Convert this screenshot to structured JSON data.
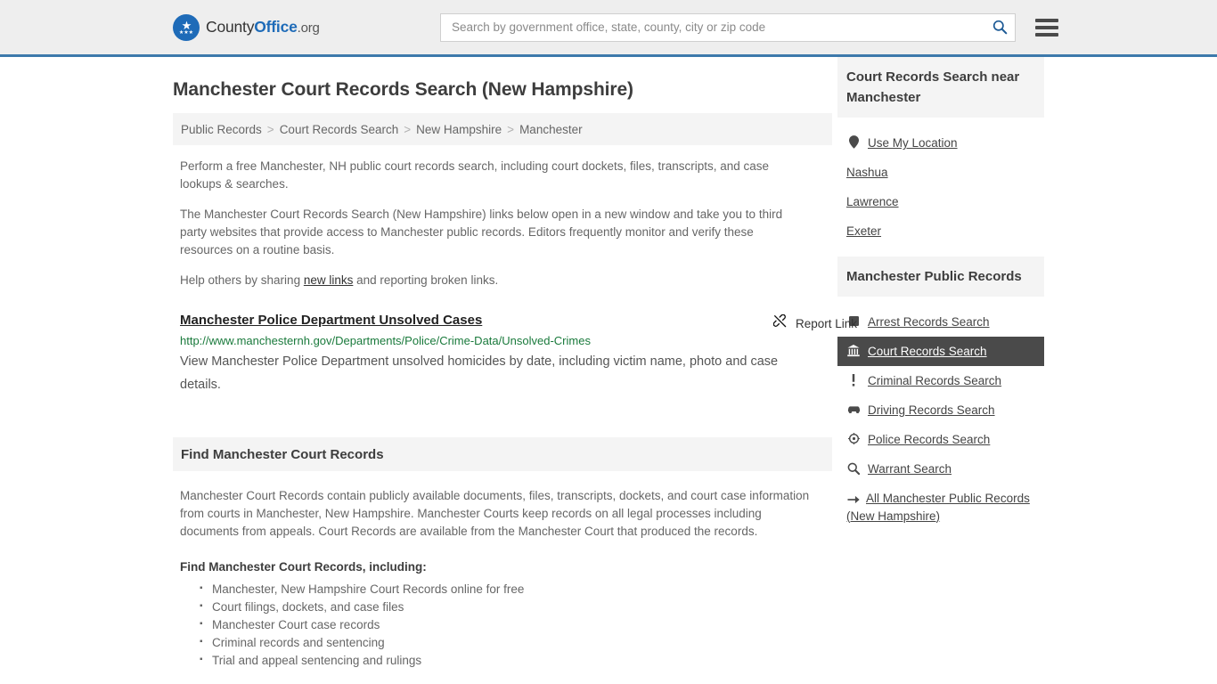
{
  "header": {
    "logo": {
      "icon": "eagle-seal-icon",
      "text_1": "County",
      "text_2": "Office",
      "text_3": ".org"
    },
    "search": {
      "placeholder": "Search by government office, state, county, city or zip code",
      "value": "",
      "icon": "search-icon"
    },
    "menu_icon": "hamburger-menu-icon",
    "accent_color": "#3c79ab"
  },
  "main": {
    "title": "Manchester Court Records Search (New Hampshire)",
    "breadcrumb": [
      {
        "label": "Public Records",
        "link": true
      },
      {
        "label": "Court Records Search",
        "link": true
      },
      {
        "label": "New Hampshire",
        "link": true
      },
      {
        "label": "Manchester",
        "link": false
      }
    ],
    "breadcrumb_separator": ">",
    "paragraphs": [
      "Perform a free Manchester, NH public court records search, including court dockets, files, transcripts, and case lookups & searches.",
      "The Manchester Court Records Search (New Hampshire) links below open in a new window and take you to third party websites that provide access to Manchester public records. Editors frequently monitor and verify these resources on a routine basis."
    ],
    "help_text_before": "Help others by sharing ",
    "help_link": "new links",
    "help_text_after": " and reporting broken links.",
    "result": {
      "title": "Manchester Police Department Unsolved Cases",
      "url": "http://www.manchesternh.gov/Departments/Police/Crime-Data/Unsolved-Crimes",
      "description": "View Manchester Police Department unsolved homicides by date, including victim name, photo and case details.",
      "report_label": "Report Link",
      "report_icon": "broken-link-icon",
      "url_color": "#1a7a3c"
    },
    "section": {
      "heading": "Find Manchester Court Records",
      "body": "Manchester Court Records contain publicly available documents, files, transcripts, dockets, and court case information from courts in Manchester, New Hampshire. Manchester Courts keep records on all legal processes including documents from appeals. Court Records are available from the Manchester Court that produced the records.",
      "list_heading": "Find Manchester Court Records, including:",
      "items": [
        "Manchester, New Hampshire Court Records online for free",
        "Court filings, dockets, and case files",
        "Manchester Court case records",
        "Criminal records and sentencing",
        "Trial and appeal sentencing and rulings"
      ]
    }
  },
  "sidebar": {
    "nearby": {
      "heading": "Court Records Search near Manchester",
      "items": [
        {
          "label": "Use My Location",
          "icon": "map-pin-icon"
        },
        {
          "label": "Nashua",
          "icon": ""
        },
        {
          "label": "Lawrence",
          "icon": ""
        },
        {
          "label": "Exeter",
          "icon": ""
        }
      ]
    },
    "public_records": {
      "heading": "Manchester Public Records",
      "items": [
        {
          "label": "Arrest Records Search",
          "icon": "square-icon",
          "active": false
        },
        {
          "label": "Court Records Search",
          "icon": "courthouse-icon",
          "active": true
        },
        {
          "label": "Criminal Records Search",
          "icon": "exclamation-icon",
          "active": false
        },
        {
          "label": "Driving Records Search",
          "icon": "car-icon",
          "active": false
        },
        {
          "label": "Police Records Search",
          "icon": "police-badge-icon",
          "active": false
        },
        {
          "label": "Warrant Search",
          "icon": "magnifier-icon",
          "active": false
        },
        {
          "label": "All Manchester Public Records (New Hampshire)",
          "icon": "arrow-right-icon",
          "active": false
        }
      ],
      "active_bg": "#4a4a4a"
    }
  }
}
